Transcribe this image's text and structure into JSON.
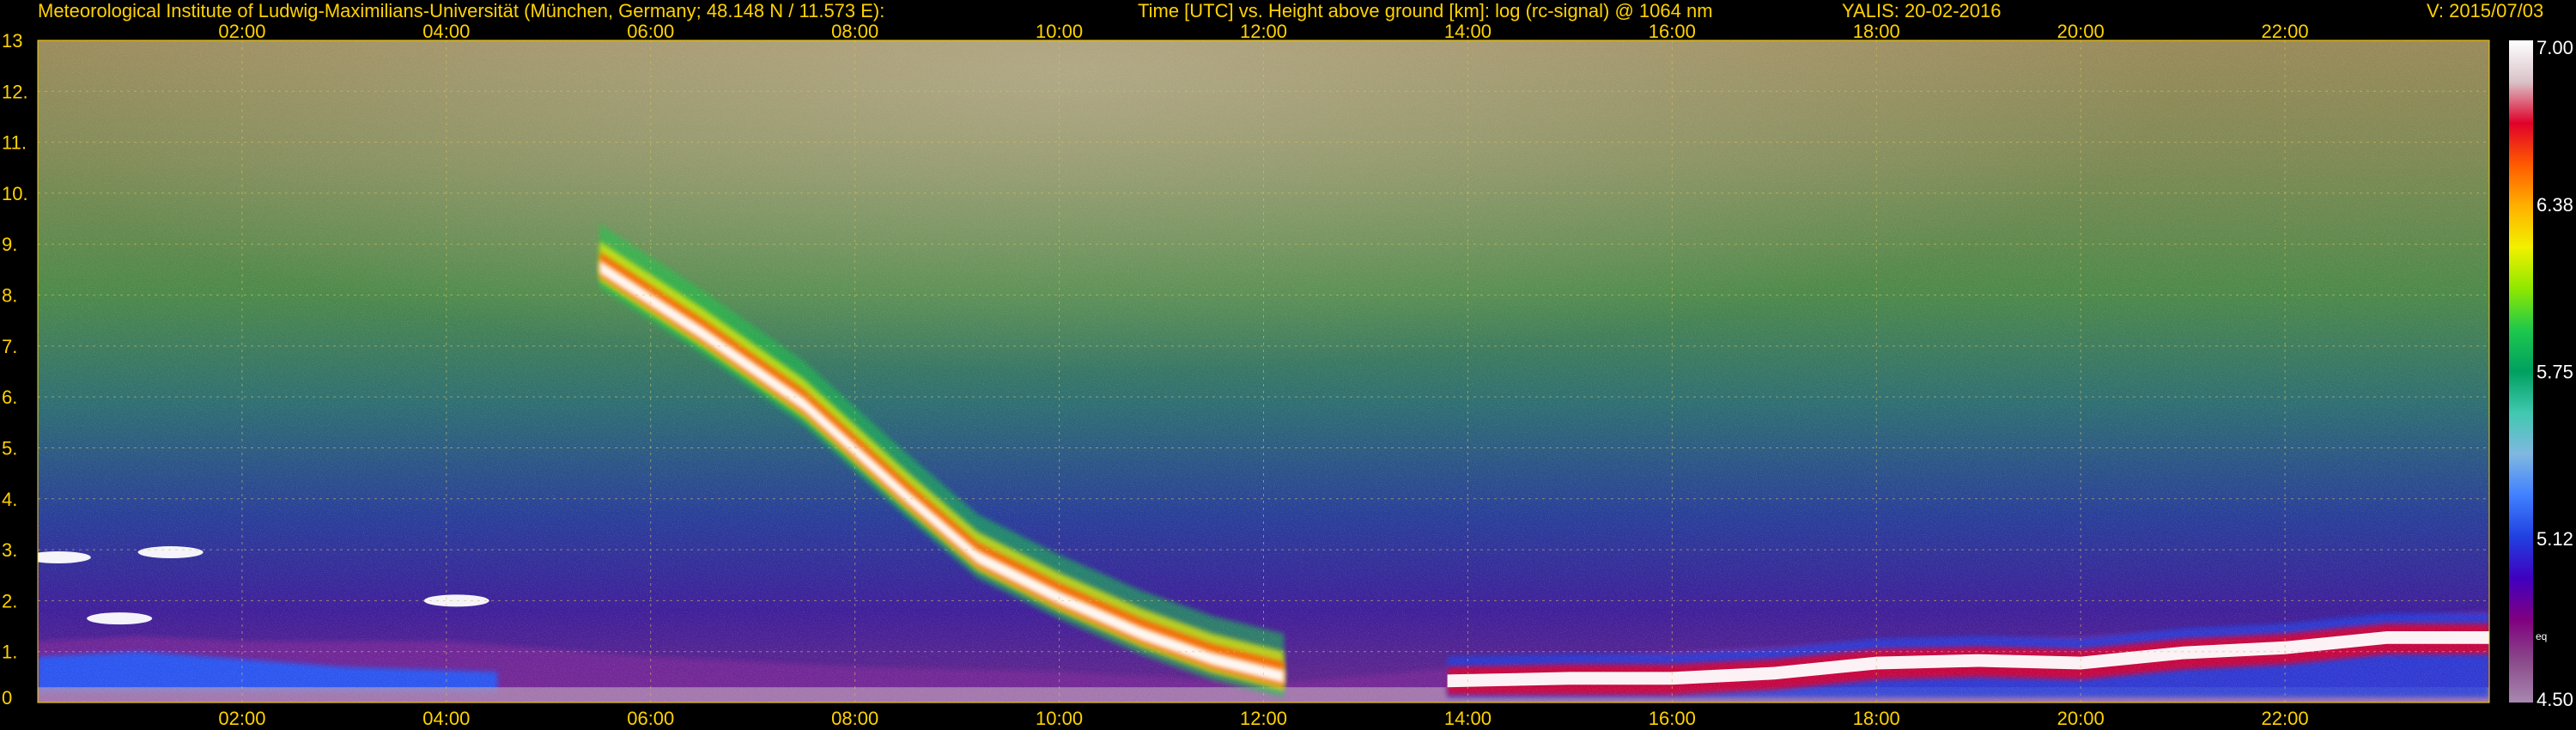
{
  "header": {
    "institute": "Meteorological Institute of Ludwig-Maximilians-Universität (München, Germany; 48.148 N / 11.573 E):",
    "axis_title": "Time [UTC] vs. Height above ground [km]: log (rc-signal) @ 1064 nm",
    "station": "YALIS: 20-02-2016",
    "version": "V: 2015/07/03"
  },
  "colorbar": {
    "labels": [
      "7.00",
      "6.38",
      "5.75",
      "5.12",
      "4.50"
    ],
    "eq_label": "eq",
    "stops": [
      "#ffffff",
      "#d9c3c9",
      "#e0002a",
      "#ff5a00",
      "#ffb000",
      "#f2f000",
      "#8ee800",
      "#1ec84c",
      "#00a060",
      "#40c8b0",
      "#80b8e0",
      "#4080ff",
      "#2040e0",
      "#4000c0",
      "#800080",
      "#8a4a8a",
      "#a888b0"
    ]
  },
  "chart_data": {
    "type": "heatmap",
    "title": "Time [UTC] vs. Height above ground [km]: log (rc-signal) @ 1064 nm",
    "xlabel": "Time [UTC]",
    "ylabel": "Height above ground [km]",
    "x_ticks": [
      "02:00",
      "04:00",
      "06:00",
      "08:00",
      "10:00",
      "12:00",
      "14:00",
      "16:00",
      "18:00",
      "20:00",
      "22:00"
    ],
    "x_tick_hours": [
      2,
      4,
      6,
      8,
      10,
      12,
      14,
      16,
      18,
      20,
      22
    ],
    "xlim_hours": [
      0,
      24
    ],
    "y_ticks": [
      "0",
      "1.",
      "2.",
      "3.",
      "4.",
      "5.",
      "6.",
      "7.",
      "8.",
      "9.",
      "10.",
      "11.",
      "12.",
      "13"
    ],
    "y_tick_values": [
      0,
      1,
      2,
      3,
      4,
      5,
      6,
      7,
      8,
      9,
      10,
      11,
      12,
      13
    ],
    "ylim_km": [
      0,
      13
    ],
    "colorbar_range": [
      4.5,
      7.0
    ],
    "colorbar_ticks": [
      7.0,
      6.38,
      5.75,
      5.12,
      4.5
    ],
    "grid": true,
    "features": {
      "boundary_layer_top": [
        {
          "hour": 0,
          "km": 1.2
        },
        {
          "hour": 1,
          "km": 1.3
        },
        {
          "hour": 2,
          "km": 1.2
        },
        {
          "hour": 4,
          "km": 1.2
        },
        {
          "hour": 6,
          "km": 0.9
        },
        {
          "hour": 8,
          "km": 0.7
        },
        {
          "hour": 10,
          "km": 0.6
        },
        {
          "hour": 11,
          "km": 0.5
        },
        {
          "hour": 12,
          "km": 0.35
        },
        {
          "hour": 14,
          "km": 0.7
        },
        {
          "hour": 16,
          "km": 1.0
        },
        {
          "hour": 18,
          "km": 1.2
        },
        {
          "hour": 20,
          "km": 1.3
        },
        {
          "hour": 22,
          "km": 1.5
        },
        {
          "hour": 24,
          "km": 1.8
        }
      ],
      "descending_cloud": [
        {
          "hour": 5.5,
          "km": 8.5
        },
        {
          "hour": 6.5,
          "km": 7.2
        },
        {
          "hour": 7.5,
          "km": 5.8
        },
        {
          "hour": 8.5,
          "km": 4.0
        },
        {
          "hour": 9.2,
          "km": 2.8
        },
        {
          "hour": 10.0,
          "km": 2.0
        },
        {
          "hour": 10.8,
          "km": 1.3
        },
        {
          "hour": 11.5,
          "km": 0.8
        },
        {
          "hour": 12.2,
          "km": 0.45
        }
      ],
      "low_stratus": [
        {
          "hour": 13.8,
          "km": 0.45
        },
        {
          "hour": 15,
          "km": 0.5
        },
        {
          "hour": 16,
          "km": 0.5
        },
        {
          "hour": 17,
          "km": 0.6
        },
        {
          "hour": 18,
          "km": 0.8
        },
        {
          "hour": 19,
          "km": 0.85
        },
        {
          "hour": 20,
          "km": 0.8
        },
        {
          "hour": 21,
          "km": 1.0
        },
        {
          "hour": 22,
          "km": 1.1
        },
        {
          "hour": 23,
          "km": 1.3
        },
        {
          "hour": 24,
          "km": 1.3
        }
      ],
      "early_clouds": [
        {
          "hour": 0.2,
          "km": 2.85
        },
        {
          "hour": 1.3,
          "km": 2.95
        },
        {
          "hour": 0.8,
          "km": 1.65
        },
        {
          "hour": 4.1,
          "km": 2.0
        }
      ]
    }
  }
}
